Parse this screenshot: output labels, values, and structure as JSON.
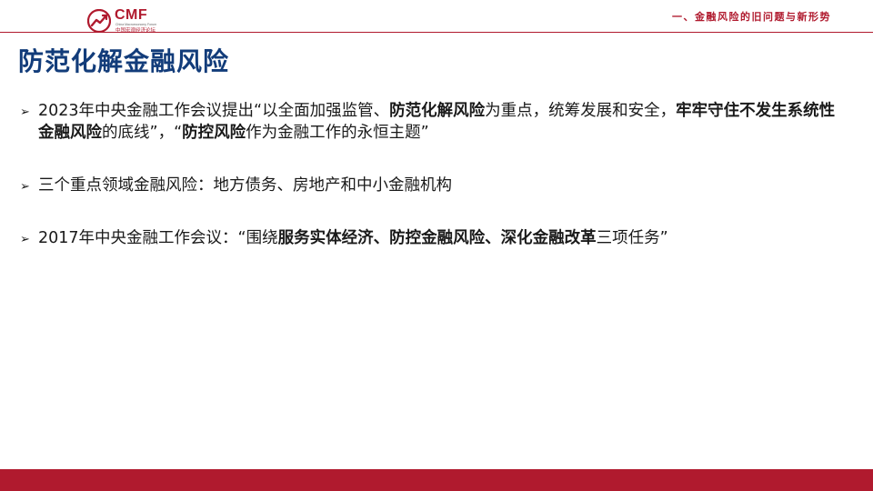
{
  "header": {
    "logo_text": "CMF",
    "logo_subtitle_en": "China Macroeconomy Forum",
    "logo_subtitle_cn": "中国宏观经济论坛",
    "section_label": "一、金融风险的旧问题与新形势"
  },
  "title": "防范化解金融风险",
  "bullets": [
    {
      "runs": [
        {
          "text": "2023年中央金融工作会议提出“以全面加强监管、",
          "bold": false
        },
        {
          "text": "防范化解风险",
          "bold": true
        },
        {
          "text": "为重点，统筹发展和安全，",
          "bold": false
        },
        {
          "text": "牢牢守住不发生系统性金融风险",
          "bold": true
        },
        {
          "text": "的底线”，“",
          "bold": false
        },
        {
          "text": "防控风险",
          "bold": true
        },
        {
          "text": "作为金融工作的永恒主题”",
          "bold": false
        }
      ]
    },
    {
      "runs": [
        {
          "text": "三个重点领域金融风险：地方债务、房地产和中小金融机构",
          "bold": false
        }
      ]
    },
    {
      "runs": [
        {
          "text": "2017年中央金融工作会议：“围绕",
          "bold": false
        },
        {
          "text": "服务实体经济、防控金融风险、深化金融改革",
          "bold": true
        },
        {
          "text": "三项任务”",
          "bold": false
        }
      ]
    }
  ],
  "bullet_icon": "arrow-bullet-icon",
  "colors": {
    "accent": "#b01a2e",
    "title": "#123c7a",
    "text": "#1a1a1a"
  }
}
